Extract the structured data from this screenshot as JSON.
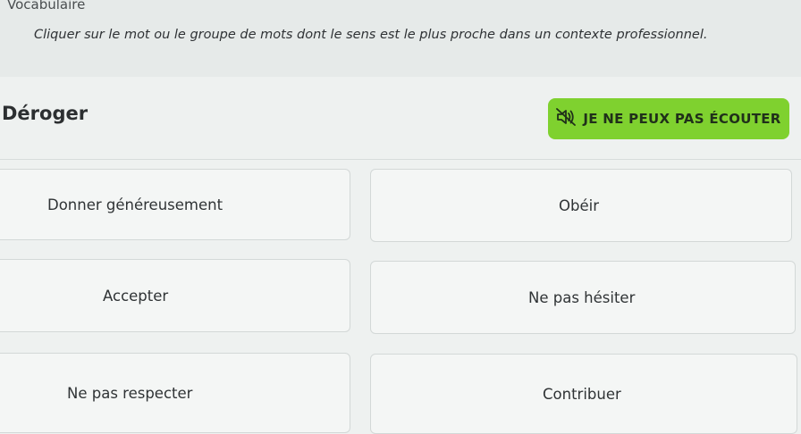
{
  "header": {
    "section_label": "Vocabulaire",
    "instructions": "Cliquer sur le mot ou le groupe de mots dont le sens est le plus proche dans un contexte professionnel."
  },
  "question": {
    "word": "Déroger"
  },
  "listen_button": {
    "label": "JE NE PEUX PAS ÉCOUTER",
    "icon": "speaker-muted-icon",
    "color": "#7fd12f"
  },
  "options": [
    {
      "label": "Donner généreusement"
    },
    {
      "label": "Obéir"
    },
    {
      "label": "Accepter"
    },
    {
      "label": "Ne pas hésiter"
    },
    {
      "label": "Ne pas respecter"
    },
    {
      "label": "Contribuer"
    }
  ]
}
